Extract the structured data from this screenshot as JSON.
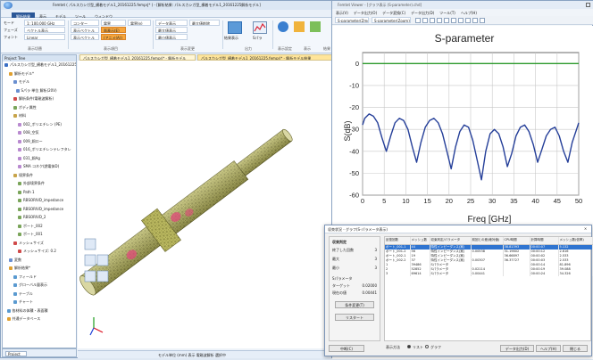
{
  "main_window": {
    "title": "Femtet ( パルスカシガ型_横着モデル1_20161225.femprj* ) - [解析結果: パルスカシガ型_横着モデル1_20161225解析モデル]",
    "menu_tabs": [
      "",
      "解析結果",
      "表示",
      "モデル",
      "ツール",
      "ウィンドウ"
    ],
    "active_tab": 1,
    "ribbon": {
      "field1_label": "モード",
      "field1_value": "1: 100.000 GHz",
      "field2_label": "フェーズ",
      "field2_value": "ベクトル表示",
      "field3_label": "フォント",
      "field3_value": "Linear",
      "field4_value": "",
      "btn_contour": "コンター",
      "btn_field": "電界",
      "btn_e_density": "電界(e)",
      "btn_vector": "表示ベクトル",
      "btn_surface": "面表示(E)",
      "btn_vector2": "表示ベクトル",
      "btn_anim": "(アニメ(A))",
      "btn_all": "データ表示",
      "btn_max": "最大値表示",
      "btn_min": "最小値表示",
      "btn_remove": "最大値削除",
      "btn_result_list": "結果表示",
      "btn_sparams": "Sパラ",
      "group_labels": [
        "表示切替",
        "表示項目",
        "表示変更",
        "出力",
        "表示設定",
        "表示",
        "結果"
      ]
    },
    "tree": {
      "header": "Project Tree",
      "items": [
        "パルスカシガ型_横着モデル1_20161225",
        "解析モデル*",
        "モデル",
        "Sパラ 単位 解析(20V)",
        "解析条件(電磁波解析)",
        "ボディ属性",
        "材料",
        "002_ポリエチレン (PE)",
        "008_空気",
        "009_銅ロー",
        "016_ポリエチレンテレフタレ",
        "031_銅Ag",
        "SMA コネク(誘電体D)",
        "境界条件",
        "外部境界条件",
        "Path 1",
        "RBSORIVD_impedance",
        "RBSORIVD_impedance",
        "RBSORIVD_2",
        "ポート_002",
        "ポート_001",
        "メッシュサイズ",
        "メッシュサイズ: 0.2",
        "変数",
        "解析結果*",
        "フィールド",
        "グローバル量表示",
        "テーブル",
        "チャート",
        "各材料の体積・表面積",
        "共通データベース"
      ],
      "bottom_tab": "Project"
    },
    "doc_tabs": [
      "パルスカシガ型_横着モデル1_20161225.femprj* - 解析モデル",
      "パルスカシガ型_横着モデル1_20161225.femprj* - 解析モデル結果"
    ],
    "status": "モデル単位 (mm) 表示 電磁波解析 選択中"
  },
  "chart_window": {
    "title": "Femtet Viewer - [グラフ表示 (S-parameter).chd]",
    "menu": [
      "表示(V)",
      "データ出力(O)",
      "データ変換(C)",
      "データ出力(D)",
      "ツール(T)",
      "ヘルプ(H)"
    ],
    "toolbar_select": "S-parameter(Zmo)",
    "toolbar_select2": "S-parameter(Zoom)"
  },
  "chart_data": {
    "type": "line",
    "title": "S-parameter",
    "xlabel": "Freq [GHz]",
    "ylabel": "S(dB)",
    "xlim": [
      0,
      50
    ],
    "ylim": [
      -60,
      5
    ],
    "xticks": [
      0,
      5,
      10,
      15,
      20,
      25,
      30,
      35,
      40,
      45,
      50
    ],
    "yticks": [
      0,
      -10,
      -20,
      -30,
      -40,
      -50,
      -60
    ],
    "grid": true,
    "series": [
      {
        "color": "#2c9a2c",
        "x": [
          0,
          50
        ],
        "y": [
          0,
          0
        ]
      },
      {
        "color": "#253f99",
        "x": [
          0,
          0.5,
          1.5,
          2.5,
          3.5,
          4.5,
          5.5,
          6.5,
          7.5,
          8.5,
          9.5,
          10.5,
          11.5,
          12.5,
          13.5,
          14.5,
          15.5,
          16.5,
          17.5,
          18.5,
          19.5,
          20.5,
          21.5,
          22.5,
          23.5,
          24.5,
          25.5,
          26.5,
          27.5,
          28.5,
          29.5,
          30.5,
          31.5,
          32.5,
          33.5,
          34.5,
          35.5,
          36.5,
          37.5,
          38.5,
          39.5,
          40.5,
          41.5,
          42.5,
          43.5,
          44.5,
          45.5,
          46.5,
          47.5,
          48.5,
          49.5,
          50
        ],
        "y": [
          -28,
          -25,
          -23,
          -24,
          -27,
          -34,
          -40,
          -33,
          -27,
          -25,
          -26,
          -30,
          -38,
          -45,
          -36,
          -29,
          -26,
          -25,
          -27,
          -32,
          -40,
          -48,
          -38,
          -31,
          -28,
          -29,
          -35,
          -44,
          -53,
          -40,
          -32,
          -30,
          -32,
          -38,
          -47,
          -41,
          -33,
          -29,
          -28,
          -31,
          -37,
          -45,
          -39,
          -33,
          -30,
          -29,
          -33,
          -40,
          -45,
          -36,
          -30,
          -27
        ]
      }
    ]
  },
  "dialog": {
    "title": "収束状況 - グラフ(S-パラメータ表示)",
    "left_header": "収束判定",
    "rows": [
      {
        "label": "終了した回数",
        "value": "3"
      },
      {
        "label": "最大",
        "value": "3"
      },
      {
        "label": "最小",
        "value": "3"
      }
    ],
    "sub_header": "Sパラメータ",
    "rows2": [
      {
        "label": "ターゲット",
        "value": "0.02000"
      },
      {
        "label": "現在の値",
        "value": "0.00441"
      }
    ],
    "btn_change": "条件変更(T)",
    "btn_restart": "リスタート",
    "columns": [
      "反復回数",
      "メッシュ数",
      "収束判定/パラメータ",
      "前回との差(絶対値)",
      "CPU時間",
      "計算時間",
      "メッシュ数(倍率)"
    ],
    "table_rows": [
      [
        "ポート_001-1",
        "44",
        "特性インピーダンス(実)",
        "",
        "38.81393",
        "00:00:07",
        "5.132"
      ],
      [
        "ポート_001-2",
        "56",
        "特性インピーダンス(実)",
        "0.00538",
        "31.19802",
        "00:00:12",
        "2.616"
      ],
      [
        "ポート_002-1",
        "19",
        "特性インピーダンス(実)",
        "",
        "36.66897",
        "00:00:02",
        "2.533"
      ],
      [
        "ポート_002-2",
        "37",
        "特性インピーダンス(実)",
        "0.00307",
        "36.37727",
        "00:00:03",
        "2.533"
      ],
      [
        "1",
        "39486",
        "Sパラメータ",
        "",
        "",
        "00:00:14",
        "81.896"
      ],
      [
        "2",
        "52852",
        "Sパラメータ",
        "0.02114",
        "",
        "00:00:19",
        "39.088"
      ],
      [
        "3",
        "69614",
        "Sパラメータ",
        "0.00441",
        "",
        "00:00:24",
        "34.326"
      ]
    ],
    "selected_row": 0,
    "display_label": "表示方法",
    "radio_list": "リスト",
    "radio_graph": "グラフ",
    "btn_data_out": "データ出力(D)",
    "btn_help": "ヘルプ(H)",
    "btn_close": "閉じる",
    "btn_stop": "中断(C)",
    "close_x": "×"
  }
}
